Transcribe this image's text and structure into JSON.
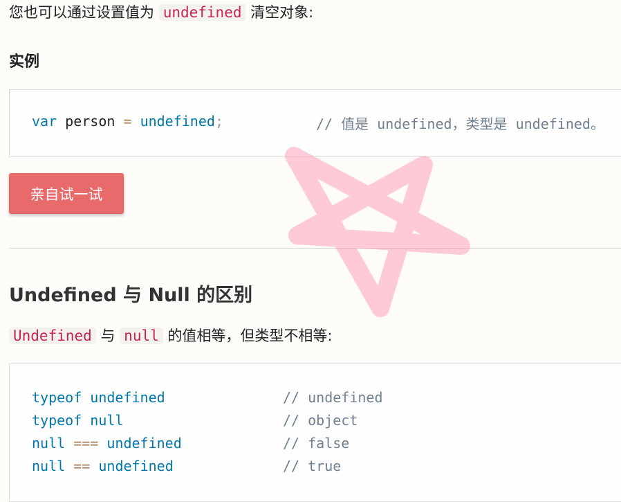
{
  "intro": {
    "before": "您也可以通过设置值为",
    "code": "undefined",
    "after": "清空对象:"
  },
  "example_heading": "实例",
  "code_block_1": {
    "var": "var",
    "ident": "person",
    "eq": "=",
    "value": "undefined",
    "semicolon": ";",
    "comment": "// 值是 undefined，类型是 undefined。"
  },
  "try_button": "亲自试一试",
  "section_heading": "Undefined 与 Null 的区别",
  "diff_para": {
    "code1": "Undefined",
    "mid": "与",
    "code2": "null",
    "after": "的值相等，但类型不相等:"
  },
  "code_block_2": {
    "lines": [
      {
        "a": "typeof undefined",
        "op": "",
        "b": "",
        "comment": "// undefined"
      },
      {
        "a": "typeof null",
        "op": "",
        "b": "",
        "comment": "// object"
      },
      {
        "a": "null",
        "op": "===",
        "b": "undefined",
        "comment": "// false"
      },
      {
        "a": "null",
        "op": "==",
        "b": "undefined",
        "comment": "// true"
      }
    ]
  },
  "colors": {
    "button": "#e96a6a",
    "inline_code": "#c7254e",
    "keyword": "#0077aa",
    "operator": "#a67f59",
    "comment": "#708090",
    "watermark": "#ff8fab"
  },
  "watermark_icon": "pentagram-watermark"
}
